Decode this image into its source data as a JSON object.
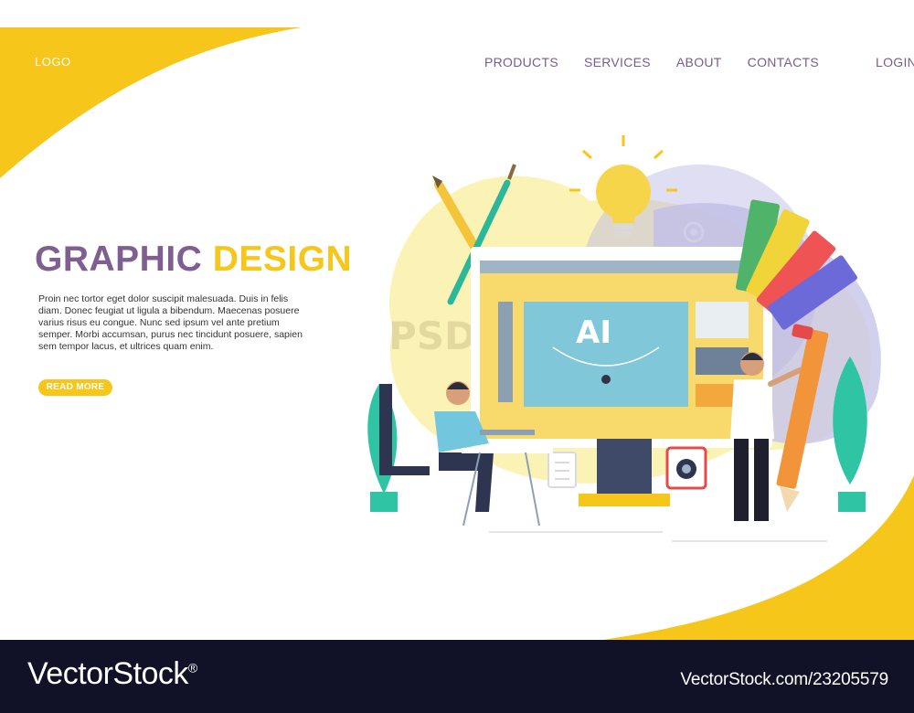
{
  "header": {
    "logo": "LOGO",
    "nav": [
      "PRODUCTS",
      "SERVICES",
      "ABOUT",
      "CONTACTS"
    ],
    "login": "LOGIN"
  },
  "hero": {
    "title_part1": "GRAPHIC",
    "title_part2": "DESIGN",
    "body": "Proin nec tortor eget dolor suscipit malesuada. Duis in felis diam. Donec feugiat ut ligula a bibendum. Maecenas posuere varius risus eu congue. Nunc sed ipsum vel ante pretium semper. Morbi accumsan, purus nec tincidunt posuere, sapien sem tempor lacus, et ultrices quam enim.",
    "cta": "READ MORE"
  },
  "illustration": {
    "screen_label": "AI",
    "psd_label": "PSD"
  },
  "watermark": {
    "brand": "VectorStock",
    "registered": "®",
    "site_id": "VectorStock.com/23205579"
  },
  "colors": {
    "accent_yellow": "#f6c61b",
    "accent_purple": "#7f5f91",
    "footer_bg": "#111128"
  }
}
